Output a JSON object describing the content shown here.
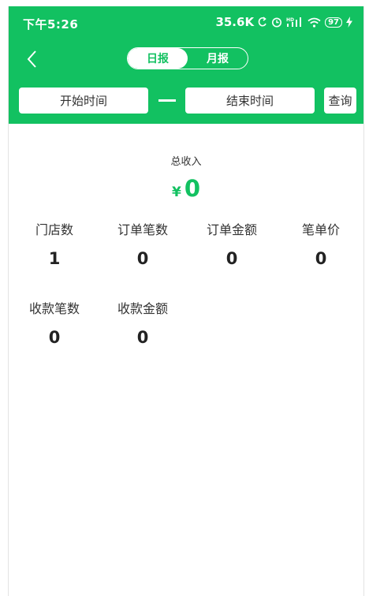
{
  "status_bar": {
    "time": "下午5:26",
    "network_speed": "35.6K",
    "battery": "97",
    "icons": [
      "sync-icon",
      "alarm-icon",
      "hd-signal-icon",
      "wifi-icon",
      "battery-icon",
      "charging-icon"
    ]
  },
  "header": {
    "background_color": "#12c161",
    "back_icon": "chevron-left-icon",
    "tabs": [
      {
        "label": "日报",
        "active": true
      },
      {
        "label": "月报",
        "active": false
      }
    ]
  },
  "filters": {
    "start_time": "开始时间",
    "end_time": "结束时间",
    "query": "查询"
  },
  "summary": {
    "total_label": "总收入",
    "currency": "¥",
    "total_value": "0"
  },
  "stats": [
    {
      "label": "门店数",
      "value": "1"
    },
    {
      "label": "订单笔数",
      "value": "0"
    },
    {
      "label": "订单金额",
      "value": "0"
    },
    {
      "label": "笔单价",
      "value": "0"
    },
    {
      "label": "收款笔数",
      "value": "0"
    },
    {
      "label": "收款金额",
      "value": "0"
    }
  ]
}
